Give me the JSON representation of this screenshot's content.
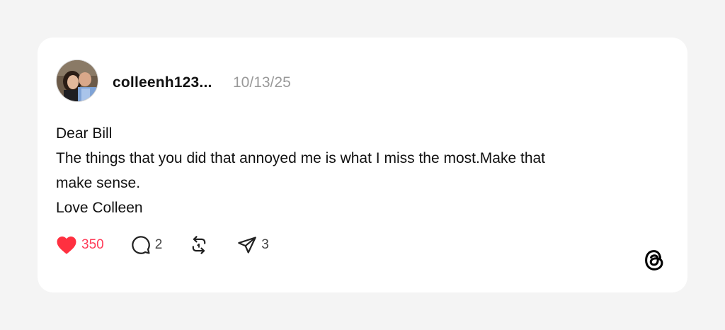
{
  "post": {
    "username": "colleenh123...",
    "timestamp": "10/13/25",
    "lines": [
      "Dear Bill",
      "The things that you did that annoyed me is what I miss the most.Make that",
      "make sense.",
      "Love Colleen"
    ]
  },
  "actions": {
    "likes": "350",
    "replies": "2",
    "shares": "3"
  },
  "icons": {
    "like": "heart-icon",
    "reply": "speech-bubble-icon",
    "repost": "repost-icon",
    "share": "send-icon",
    "brand": "threads-logo-icon"
  },
  "colors": {
    "like_active": "#ff3b58",
    "muted_text": "#999999"
  }
}
